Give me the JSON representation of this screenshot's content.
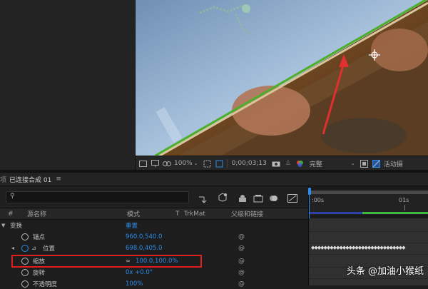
{
  "viewer_toolbar": {
    "zoom": "100%",
    "timecode": "0;00;03;13",
    "resolution": "完整",
    "active_camera": "活动摄"
  },
  "timeline": {
    "comp_tab": "已连接合成 01",
    "tab_prefix": "项",
    "search_placeholder": "",
    "columns": {
      "hash": "#",
      "source_name": "源名称",
      "mode": "模式",
      "t": "T",
      "trkmat": "TrkMat",
      "parent": "父级和链接"
    },
    "rows": [
      {
        "name": "变换",
        "value": "重置"
      },
      {
        "name": "锚点",
        "value": "960.0,540.0"
      },
      {
        "name": "位置",
        "value": "698.0,405.0"
      },
      {
        "name": "缩放",
        "value": "100.0,100.0%"
      },
      {
        "name": "旋转",
        "value": "0x +0.0°"
      },
      {
        "name": "不透明度",
        "value": "100%"
      }
    ],
    "ruler": {
      "start": ":00s",
      "mark": "01s"
    }
  },
  "watermark": {
    "text": "头条 @加油小猴纸"
  },
  "colors": {
    "accent_blue": "#2d8ceb",
    "highlight_red": "#e02020",
    "edge_green": "#4caf2a"
  }
}
